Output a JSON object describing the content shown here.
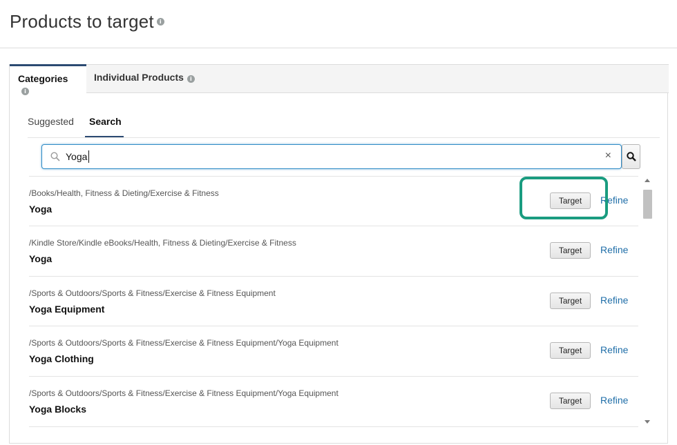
{
  "page": {
    "title": "Products to target",
    "info_icon": "i"
  },
  "tabs": [
    {
      "label": "Categories",
      "active": true
    },
    {
      "label": "Individual Products",
      "active": false
    }
  ],
  "subtabs": [
    {
      "label": "Suggested",
      "active": false
    },
    {
      "label": "Search",
      "active": true
    }
  ],
  "search": {
    "value": "Yoga",
    "placeholder": "",
    "clear_symbol": "×",
    "icon": "search-icon"
  },
  "results": [
    {
      "path": "/Books/Health, Fitness & Dieting/Exercise & Fitness",
      "name": "Yoga",
      "target_label": "Target",
      "refine_label": "Refine"
    },
    {
      "path": "/Kindle Store/Kindle eBooks/Health, Fitness & Dieting/Exercise & Fitness",
      "name": "Yoga",
      "target_label": "Target",
      "refine_label": "Refine"
    },
    {
      "path": "/Sports & Outdoors/Sports & Fitness/Exercise & Fitness Equipment",
      "name": "Yoga Equipment",
      "target_label": "Target",
      "refine_label": "Refine"
    },
    {
      "path": "/Sports & Outdoors/Sports & Fitness/Exercise & Fitness Equipment/Yoga Equipment",
      "name": "Yoga Clothing",
      "target_label": "Target",
      "refine_label": "Refine"
    },
    {
      "path": "/Sports & Outdoors/Sports & Fitness/Exercise & Fitness Equipment/Yoga Equipment",
      "name": "Yoga Blocks",
      "target_label": "Target",
      "refine_label": "Refine"
    }
  ],
  "colors": {
    "accent": "#2b4a72",
    "link": "#1f6ea8",
    "highlight": "#1a9c80",
    "focus": "#2e8bc6"
  }
}
